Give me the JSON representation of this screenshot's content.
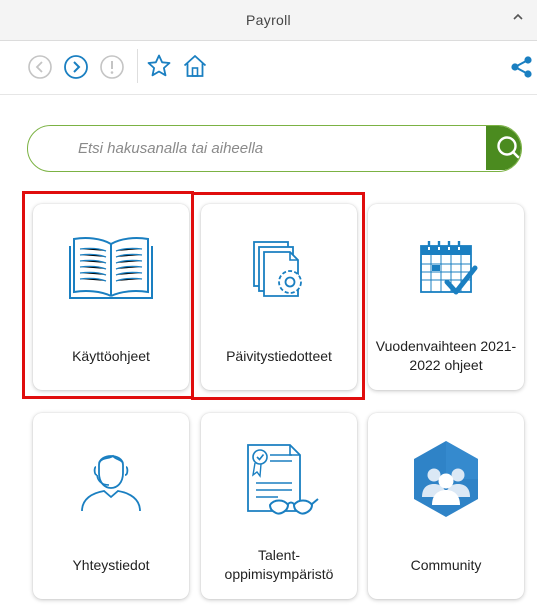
{
  "window": {
    "title": "Payroll"
  },
  "search": {
    "placeholder": "Etsi hakusanalla tai aiheella",
    "value": ""
  },
  "tiles": [
    {
      "label": "Käyttöohjeet",
      "icon": "book-icon"
    },
    {
      "label": "Päivitystiedotteet",
      "icon": "documents-gear-icon"
    },
    {
      "label": "Vuodenvaihteen 2021-2022 ohjeet",
      "icon": "calendar-check-icon"
    },
    {
      "label": "Yhteystiedot",
      "icon": "support-agent-icon"
    },
    {
      "label": "Talent-oppimisympäristö",
      "icon": "certificate-glasses-icon"
    },
    {
      "label": "Community",
      "icon": "community-hexagon-icon"
    }
  ],
  "colors": {
    "accent": "#1a7fc1",
    "search_border": "#7bb243",
    "search_button": "#4b8b1f",
    "highlight": "#e00d0d"
  }
}
